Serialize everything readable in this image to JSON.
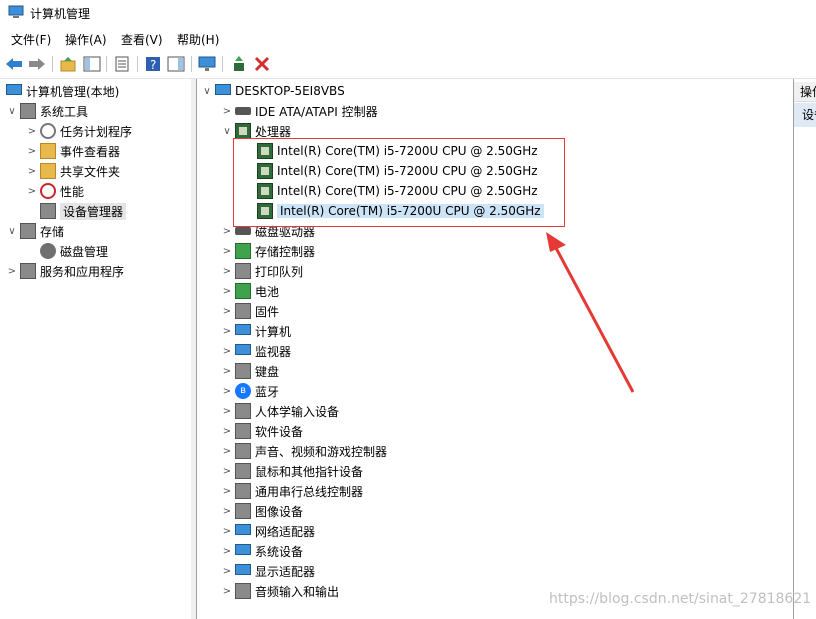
{
  "window": {
    "title": "计算机管理"
  },
  "menu": [
    "文件(F)",
    "操作(A)",
    "查看(V)",
    "帮助(H)"
  ],
  "toolbar": [
    "back-icon",
    "forward-icon",
    "up-folder-icon",
    "show-hide-tree-icon",
    "properties-icon",
    "help-icon",
    "action-pane-icon",
    "monitor-icon",
    "update-driver-icon",
    "uninstall-icon"
  ],
  "left_tree": {
    "root": "计算机管理(本地)",
    "system_tools": "系统工具",
    "task_scheduler": "任务计划程序",
    "event_viewer": "事件查看器",
    "shared_folders": "共享文件夹",
    "performance": "性能",
    "device_manager": "设备管理器",
    "storage": "存储",
    "disk_management": "磁盘管理",
    "services_apps": "服务和应用程序"
  },
  "device_tree": {
    "computer": "DESKTOP-5EI8VBS",
    "ide": "IDE ATA/ATAPI 控制器",
    "processors": "处理器",
    "cpus": [
      "Intel(R) Core(TM) i5-7200U CPU @ 2.50GHz",
      "Intel(R) Core(TM) i5-7200U CPU @ 2.50GHz",
      "Intel(R) Core(TM) i5-7200U CPU @ 2.50GHz",
      "Intel(R) Core(TM) i5-7200U CPU @ 2.50GHz"
    ],
    "categories": [
      "磁盘驱动器",
      "存储控制器",
      "打印队列",
      "电池",
      "固件",
      "计算机",
      "监视器",
      "键盘",
      "蓝牙",
      "人体学输入设备",
      "软件设备",
      "声音、视频和游戏控制器",
      "鼠标和其他指针设备",
      "通用串行总线控制器",
      "图像设备",
      "网络适配器",
      "系统设备",
      "显示适配器",
      "音频输入和输出"
    ]
  },
  "right_pane": {
    "header": "操作",
    "sub": "设备"
  },
  "watermark": "https://blog.csdn.net/sinat_27818621",
  "colors": {
    "highlight_box": "#e53935",
    "arrow": "#e53935",
    "selected_row": "#cce4f7"
  }
}
